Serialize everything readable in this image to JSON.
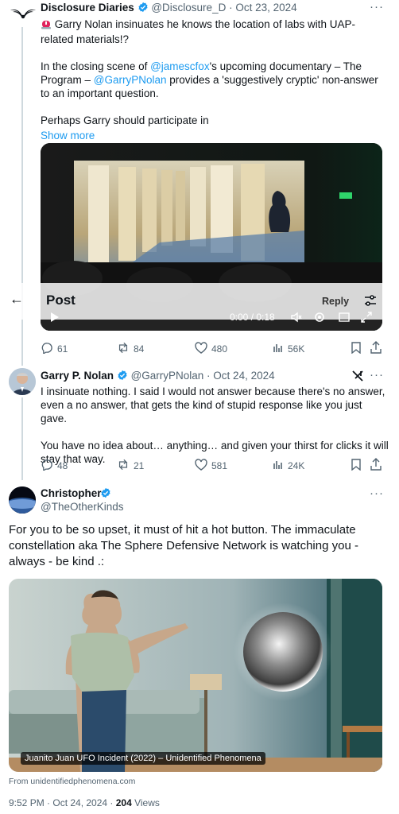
{
  "tweet1": {
    "author_name": "Disclosure Diaries",
    "handle_date": "@Disclosure_D · Oct 23, 2024",
    "line1": "Garry Nolan insinuates he knows the location of labs with UAP-related materials!?",
    "line2_pre": "In the closing scene of ",
    "line2_mention1": "@jamescfox",
    "line2_mid": "'s upcoming documentary – The Program – ",
    "line2_mention2": "@GarryPNolan",
    "line2_post": " provides a 'suggestively cryptic' non-answer to an important question.",
    "line3": "Perhaps Garry should participate in",
    "show_more": "Show more",
    "video_time": "0:00 / 0:18",
    "stats": {
      "replies": "61",
      "reposts": "84",
      "likes": "480",
      "views": "56K"
    }
  },
  "post_header": {
    "back_label": "←",
    "title": "Post",
    "reply_label": "Reply"
  },
  "tweet2": {
    "author_name": "Garry P. Nolan",
    "handle_date": "@GarryPNolan · Oct 24, 2024",
    "para1": "I insinuate nothing.  I said I would not answer because there's no answer, even a no answer, that gets the kind of stupid response like you just gave.",
    "para2": "You have no idea about… anything…  and given your thirst for clicks it will stay that way.",
    "stats": {
      "replies": "48",
      "reposts": "21",
      "likes": "581",
      "views": "24K"
    }
  },
  "tweet3": {
    "author_name": "Christopher",
    "handle": "@TheOtherKinds",
    "body": "For you to be so upset, it must of hit a hot button. The immaculate constellation aka The Sphere Defensive Network is watching you - always - be kind .:",
    "image_caption": "Juanito Juan UFO Incident (2022) – Unidentified Phenomena",
    "source": "From unidentifiedphenomena.com",
    "time_date": "9:52 PM · Oct 24, 2024 · ",
    "views_count": "204",
    "views_label": " Views"
  },
  "colors": {
    "accent": "#1d9bf0",
    "muted": "#536471",
    "text": "#0f1419",
    "border": "#cfd9de"
  },
  "icons": [
    "bird-logo-icon",
    "siren-emoji-icon",
    "verified-badge-icon",
    "reply-icon",
    "repost-icon",
    "like-icon",
    "views-icon",
    "bookmark-icon",
    "share-icon",
    "play-icon",
    "volume-icon",
    "settings-icon",
    "fullscreen-icon",
    "grok-icon",
    "sliders-icon",
    "back-arrow-icon"
  ]
}
